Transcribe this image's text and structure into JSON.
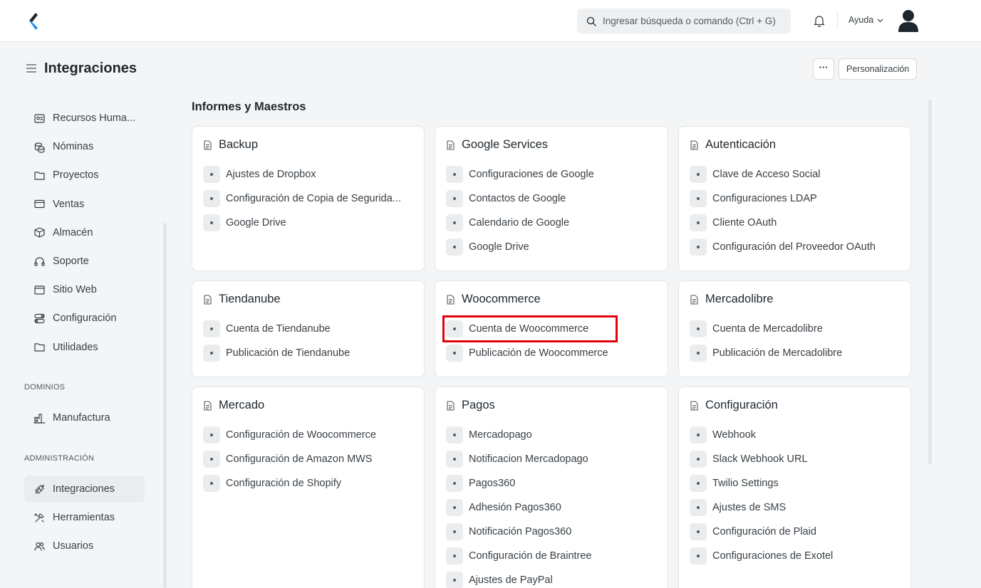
{
  "navbar": {
    "search_placeholder": "Ingresar búsqueda o comando (Ctrl + G)",
    "help_label": "Ayuda"
  },
  "page": {
    "title": "Integraciones",
    "more_label": "···",
    "customize_label": "Personalización"
  },
  "sidebar": {
    "items": [
      {
        "label": "Recursos Huma...",
        "icon": "id-card-icon"
      },
      {
        "label": "Nóminas",
        "icon": "coins-icon"
      },
      {
        "label": "Proyectos",
        "icon": "folder-icon"
      },
      {
        "label": "Ventas",
        "icon": "card-icon"
      },
      {
        "label": "Almacén",
        "icon": "box-icon"
      },
      {
        "label": "Soporte",
        "icon": "headset-icon"
      },
      {
        "label": "Sitio Web",
        "icon": "browser-icon"
      },
      {
        "label": "Configuración",
        "icon": "toggle-icon"
      },
      {
        "label": "Utilidades",
        "icon": "folder-icon"
      }
    ],
    "domains_heading": "DOMINIOS",
    "domains": [
      {
        "label": "Manufactura",
        "icon": "factory-icon"
      }
    ],
    "admin_heading": "ADMINISTRACIÓN",
    "admin": [
      {
        "label": "Integraciones",
        "icon": "plug-icon",
        "active": true
      },
      {
        "label": "Herramientas",
        "icon": "tools-icon"
      },
      {
        "label": "Usuarios",
        "icon": "users-icon"
      }
    ]
  },
  "main": {
    "section_title": "Informes y Maestros",
    "cards": [
      {
        "title": "Backup",
        "links": [
          "Ajustes de Dropbox",
          "Configuración de Copia de Segurida...",
          "Google Drive"
        ]
      },
      {
        "title": "Google Services",
        "links": [
          "Configuraciones de Google",
          "Contactos de Google",
          "Calendario de Google",
          "Google Drive"
        ]
      },
      {
        "title": "Autenticación",
        "links": [
          "Clave de Acceso Social",
          "Configuraciones LDAP",
          "Cliente OAuth",
          "Configuración del Proveedor OAuth"
        ]
      },
      {
        "title": "Tiendanube",
        "links": [
          "Cuenta de Tiendanube",
          "Publicación de Tiendanube"
        ]
      },
      {
        "title": "Woocommerce",
        "links": [
          "Cuenta de Woocommerce",
          "Publicación de Woocommerce"
        ]
      },
      {
        "title": "Mercadolibre",
        "links": [
          "Cuenta de Mercadolibre",
          "Publicación de Mercadolibre"
        ]
      },
      {
        "title": "Mercado",
        "links": [
          "Configuración de Woocommerce",
          "Configuración de Amazon MWS",
          "Configuración de Shopify"
        ]
      },
      {
        "title": "Pagos",
        "links": [
          "Mercadopago",
          "Notificacion Mercadopago",
          "Pagos360",
          "Adhesión Pagos360",
          "Notificación Pagos360",
          "Configuración de Braintree",
          "Ajustes de PayPal"
        ]
      },
      {
        "title": "Configuración",
        "links": [
          "Webhook",
          "Slack Webhook URL",
          "Twilio Settings",
          "Ajustes de SMS",
          "Configuración de Plaid",
          "Configuraciones de Exotel"
        ]
      }
    ]
  }
}
